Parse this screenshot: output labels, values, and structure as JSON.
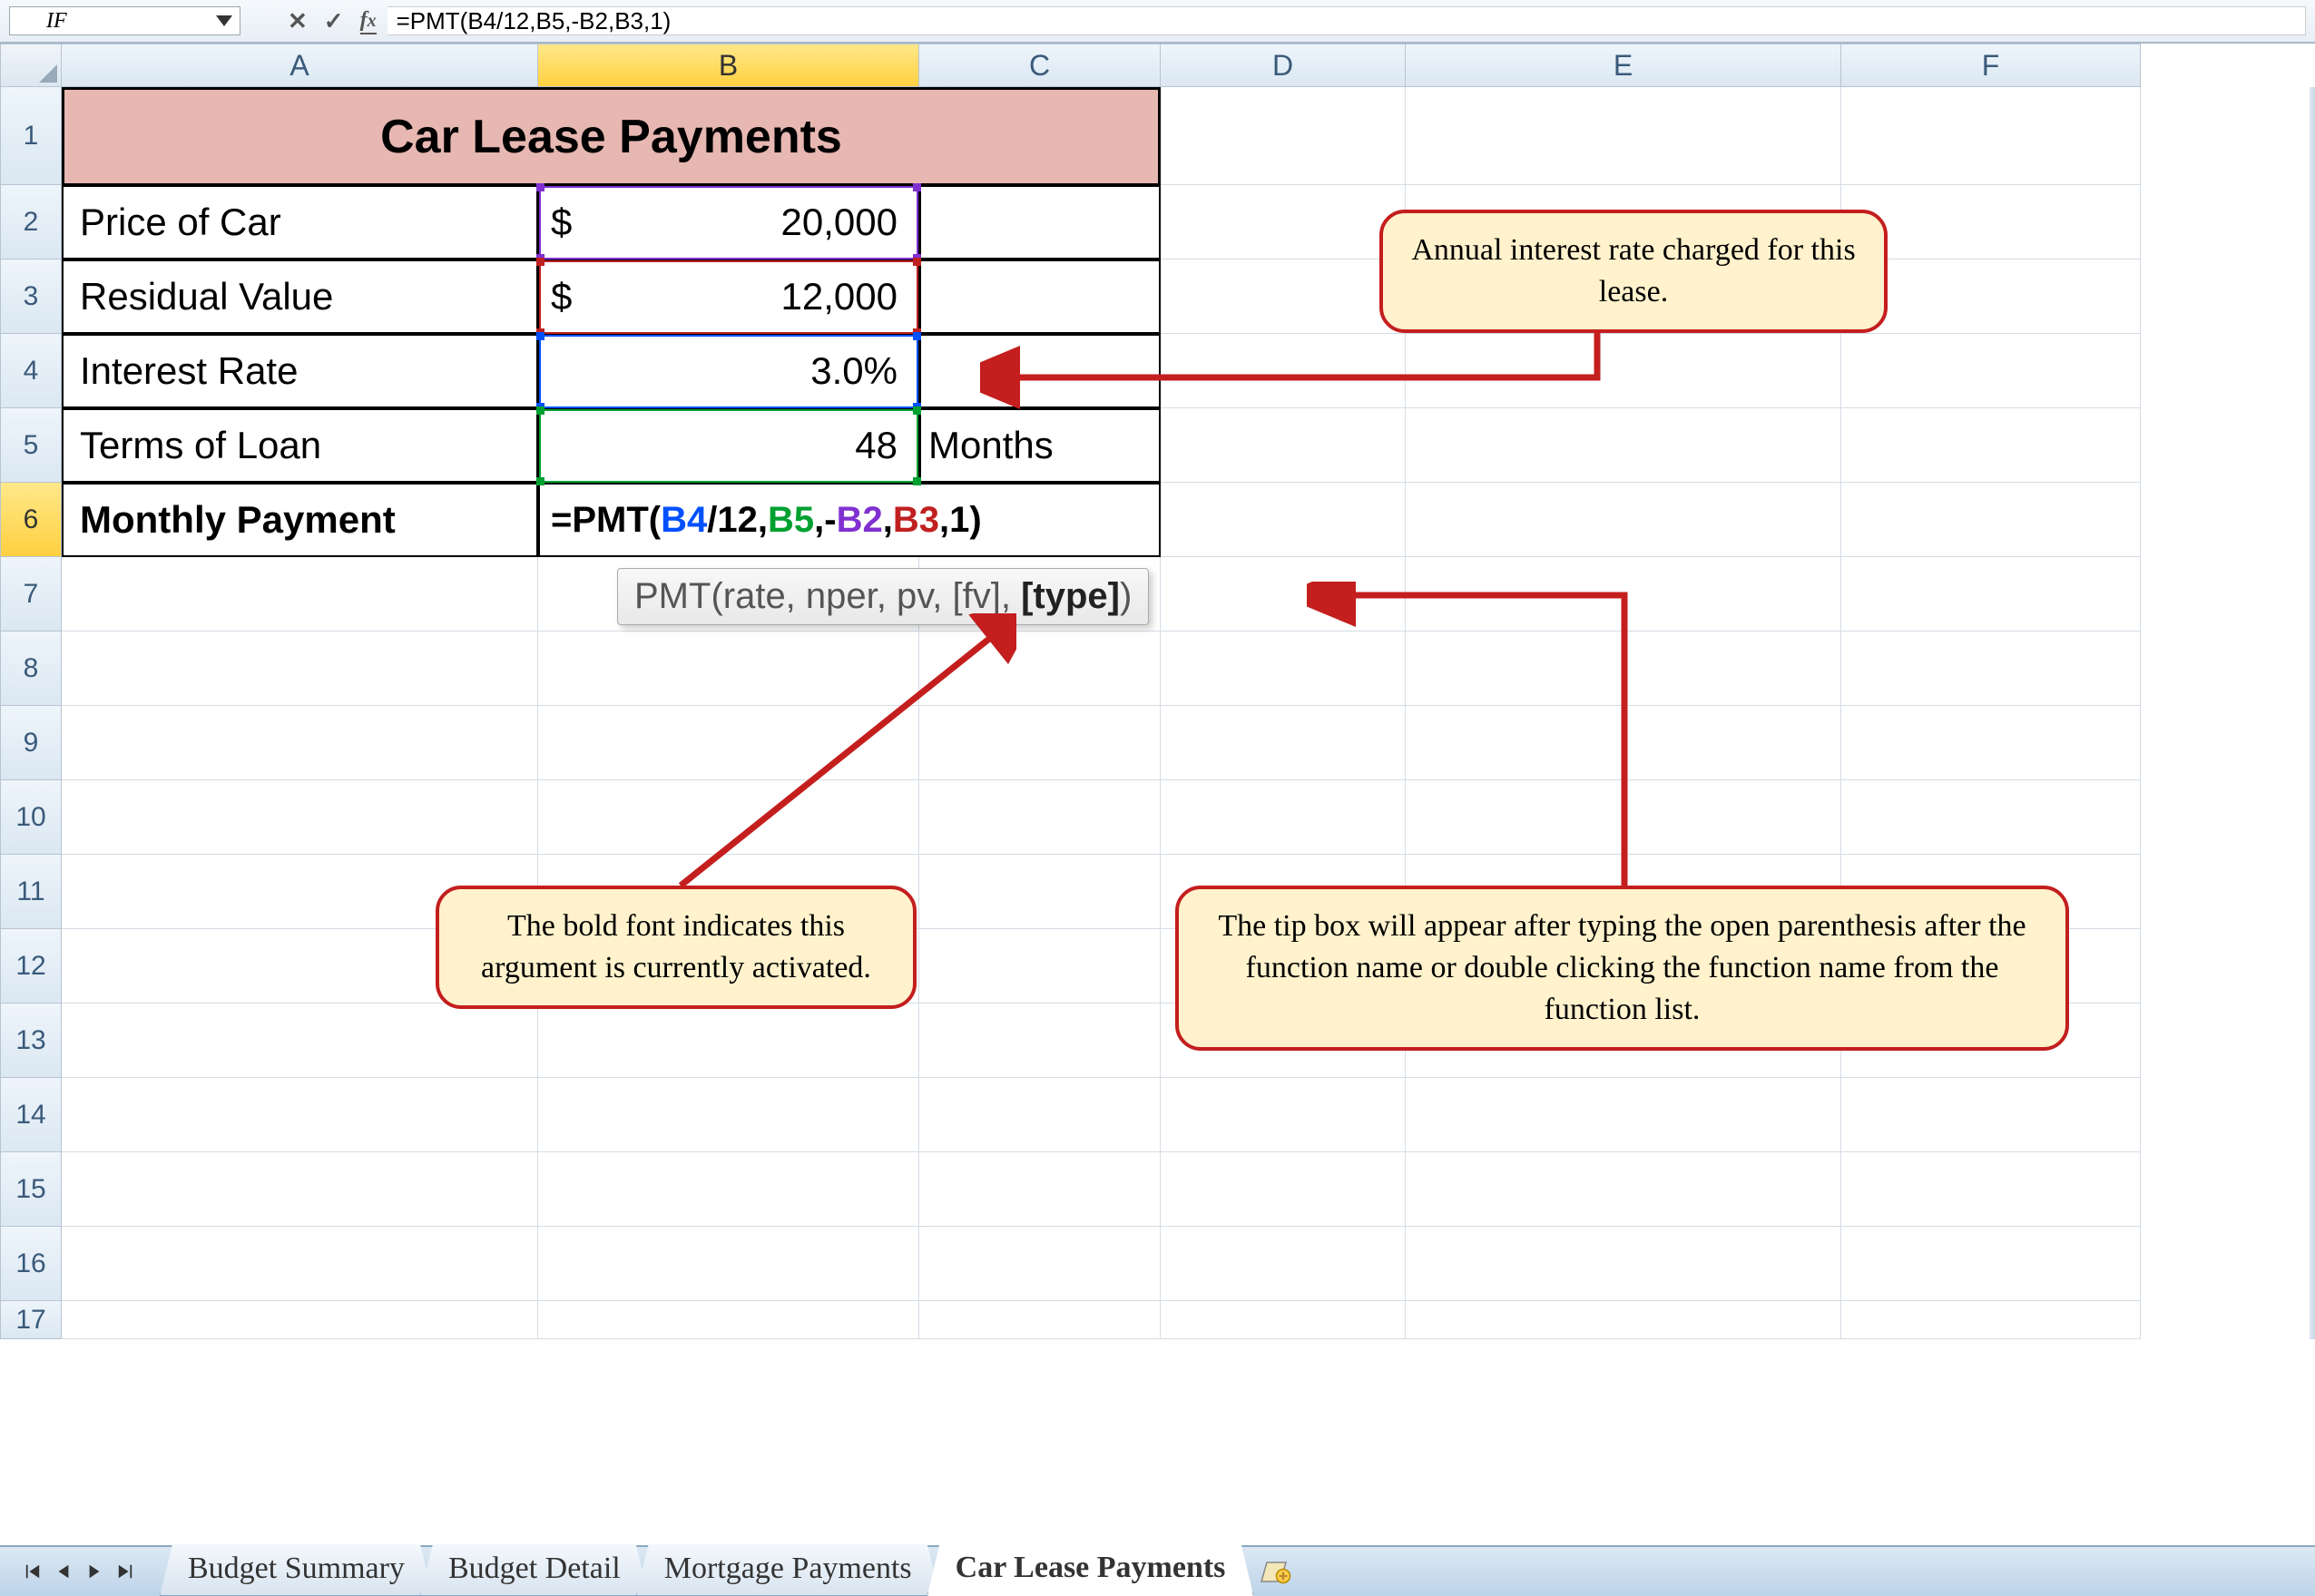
{
  "name_box": "IF",
  "formula_bar": "=PMT(B4/12,B5,-B2,B3,1)",
  "columns": [
    "A",
    "B",
    "C",
    "D",
    "E",
    "F"
  ],
  "active_column": "B",
  "active_row": "6",
  "rows": [
    "1",
    "2",
    "3",
    "4",
    "5",
    "6",
    "7",
    "8",
    "9",
    "10",
    "11",
    "12",
    "13",
    "14",
    "15",
    "16",
    "17"
  ],
  "sheet": {
    "title": "Car Lease Payments",
    "row2": {
      "label": "Price of Car",
      "currency": "$",
      "value": "20,000"
    },
    "row3": {
      "label": "Residual Value",
      "currency": "$",
      "value": "12,000"
    },
    "row4": {
      "label": "Interest Rate",
      "value": "3.0%"
    },
    "row5": {
      "label": "Terms of Loan",
      "value": "48",
      "unit": "Months"
    },
    "row6": {
      "label": "Monthly Payment",
      "formula_prefix": "=PMT(",
      "b4": "B4",
      "div": "/12,",
      "b5": "B5",
      "c1": ",-",
      "b2": "B2",
      "c2": ",",
      "b3": "B3",
      "suffix": ",1)"
    }
  },
  "tooltip": {
    "fn": "PMT",
    "args_pre": "(rate, nper, pv, [fv], ",
    "bold": "[type]",
    "close": ")"
  },
  "callouts": {
    "c1": "Annual interest rate charged for this lease.",
    "c2": "The bold font indicates this argument is currently activated.",
    "c3": "The tip box will appear after typing the open parenthesis after the function name or double clicking the function name from the function list."
  },
  "tabs": [
    "Budget Summary",
    "Budget Detail",
    "Mortgage Payments",
    "Car Lease Payments"
  ],
  "active_tab": "Car Lease Payments"
}
